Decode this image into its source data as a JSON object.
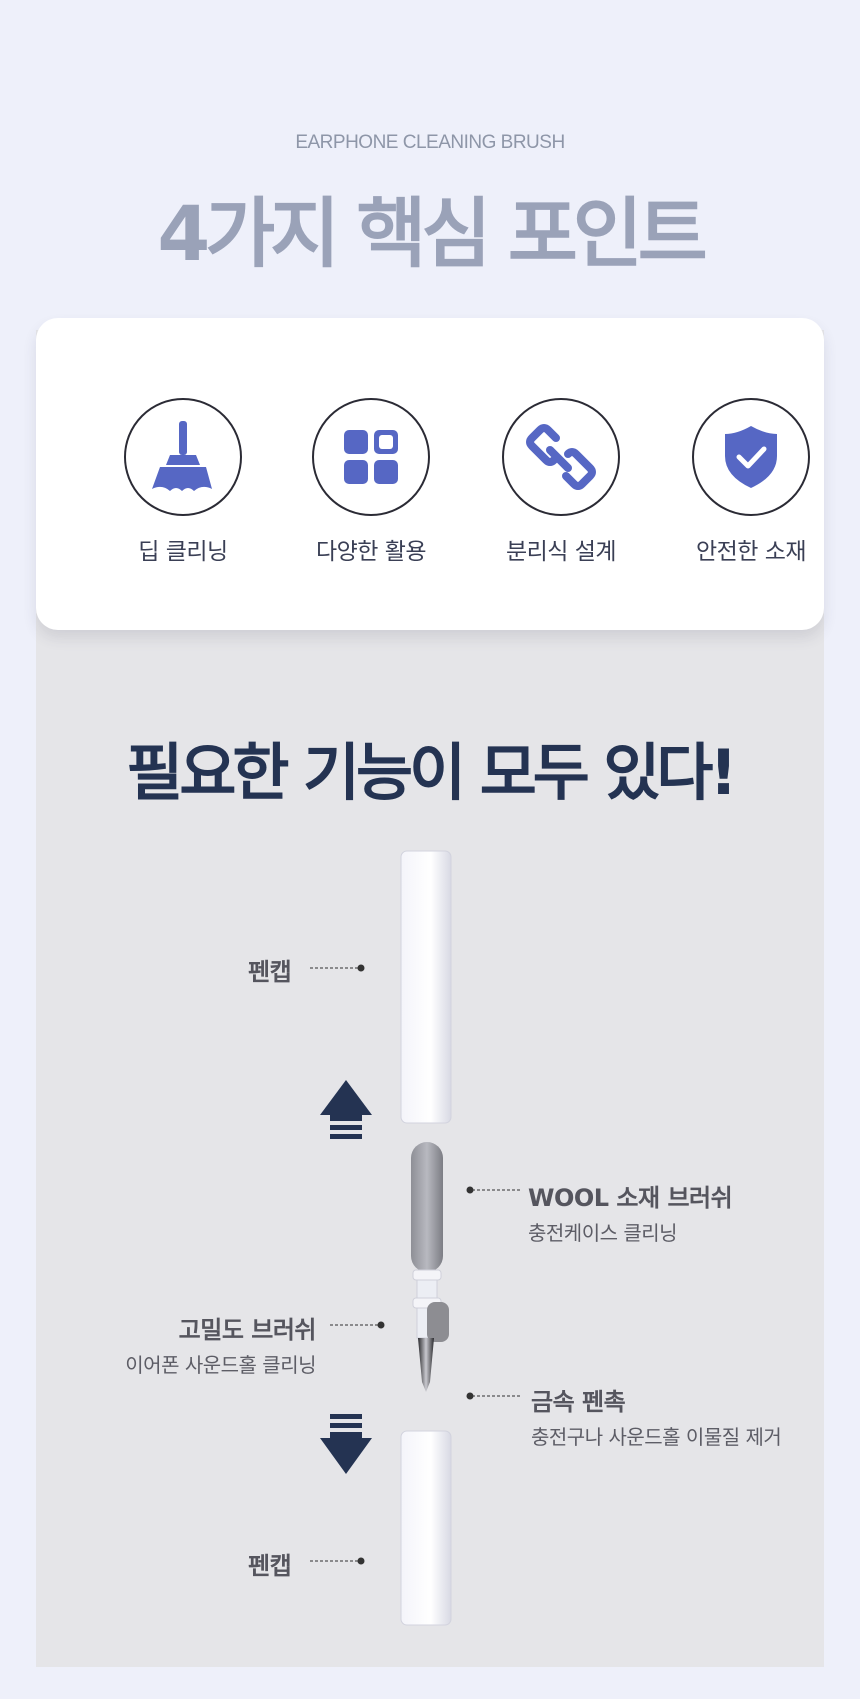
{
  "header": {
    "eyebrow": "EARPHONE CLEANING BRUSH",
    "title": "4가지 핵심 포인트"
  },
  "points": [
    {
      "label": "딥 클리닝",
      "icon": "broom-icon"
    },
    {
      "label": "다양한 활용",
      "icon": "grid-icon"
    },
    {
      "label": "분리식 설계",
      "icon": "link-icon"
    },
    {
      "label": "안전한 소재",
      "icon": "shield-check-icon"
    }
  ],
  "colors": {
    "accent": "#5667c4",
    "navy": "#243352",
    "background": "#eef0fa",
    "panel": "#e5e5e8"
  },
  "features": {
    "headline": "필요한 기능이 모두 있다!",
    "pen_cap_top": "펜캡",
    "pen_cap_bottom": "펜캡",
    "wool_brush_title": "WOOL 소재 브러쉬",
    "wool_brush_desc": "충전케이스 클리닝",
    "dense_brush_title": "고밀도 브러쉬",
    "dense_brush_desc": "이어폰 사운드홀 클리닝",
    "metal_tip_title": "금속 펜촉",
    "metal_tip_desc": "충전구나 사운드홀 이물질 제거"
  }
}
